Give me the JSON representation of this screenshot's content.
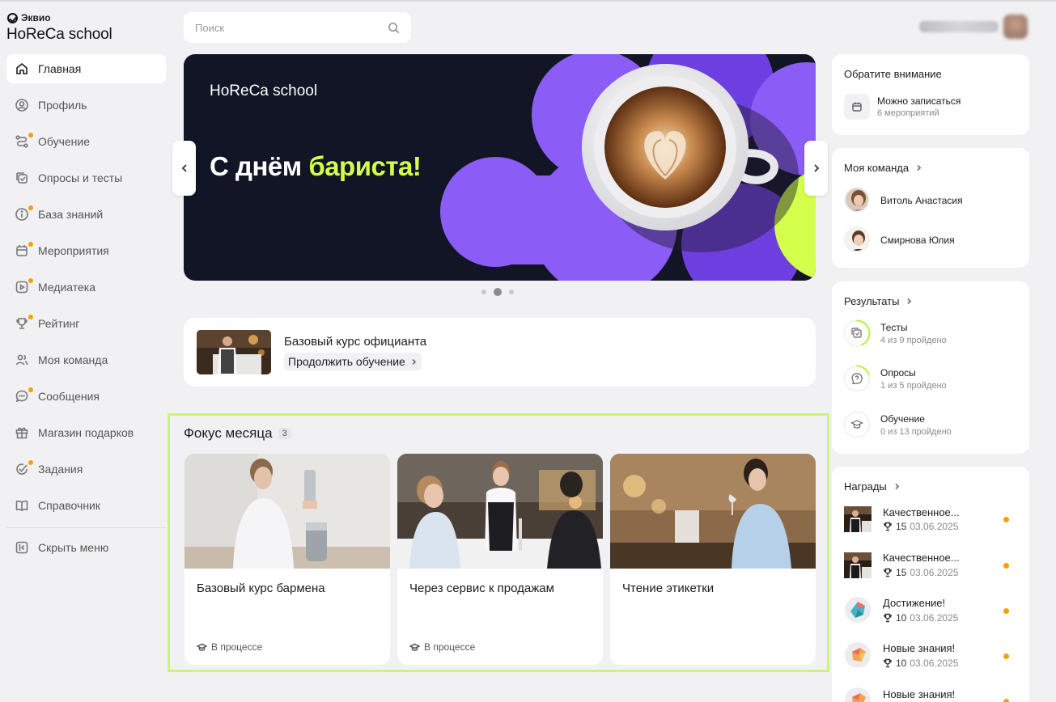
{
  "app": {
    "brand_small": "Эквио",
    "brand_title": "HoReCa school"
  },
  "sidebar": {
    "items": [
      {
        "label": "Главная",
        "icon": "home-icon",
        "active": true,
        "dot": false
      },
      {
        "label": "Профиль",
        "icon": "profile-icon",
        "active": false,
        "dot": false
      },
      {
        "label": "Обучение",
        "icon": "learning-icon",
        "active": false,
        "dot": true
      },
      {
        "label": "Опросы и тесты",
        "icon": "tests-icon",
        "active": false,
        "dot": false
      },
      {
        "label": "База знаний",
        "icon": "info-icon",
        "active": false,
        "dot": true
      },
      {
        "label": "Мероприятия",
        "icon": "calendar-icon",
        "active": false,
        "dot": true
      },
      {
        "label": "Медиатека",
        "icon": "play-icon",
        "active": false,
        "dot": true
      },
      {
        "label": "Рейтинг",
        "icon": "trophy-icon",
        "active": false,
        "dot": true
      },
      {
        "label": "Моя команда",
        "icon": "team-icon",
        "active": false,
        "dot": false
      },
      {
        "label": "Сообщения",
        "icon": "chat-icon",
        "active": false,
        "dot": true
      },
      {
        "label": "Магазин подарков",
        "icon": "gift-icon",
        "active": false,
        "dot": false
      },
      {
        "label": "Задания",
        "icon": "task-icon",
        "active": false,
        "dot": true
      },
      {
        "label": "Справочник",
        "icon": "book-icon",
        "active": false,
        "dot": false
      }
    ],
    "hide_menu": "Скрыть меню"
  },
  "search": {
    "placeholder": "Поиск"
  },
  "banner": {
    "brand": "HoReCa school",
    "title_plain": "С днём ",
    "title_highlight": "бариста!",
    "highlight_color": "#d4ff4a",
    "accent_color": "#8b5cf6",
    "slides": 3,
    "current_slide": 2
  },
  "continue_card": {
    "title": "Базовый курс официанта",
    "button": "Продолжить обучение"
  },
  "focus": {
    "title": "Фокус месяца",
    "count": "3",
    "cards": [
      {
        "title": "Базовый курс бармена",
        "status": "В процессе"
      },
      {
        "title": "Через сервис к продажам",
        "status": "В процессе"
      },
      {
        "title": "Чтение этикетки",
        "status": ""
      }
    ]
  },
  "attention": {
    "title": "Обратите внимание",
    "item_title": "Можно записаться",
    "item_sub": "6 мероприятий"
  },
  "team": {
    "title": "Моя команда",
    "members": [
      "Витоль Анастасия",
      "Смирнова Юлия"
    ]
  },
  "results": {
    "title": "Результаты",
    "items": [
      {
        "label": "Тесты",
        "sub": "4 из 9 пройдено",
        "progress": 0.44
      },
      {
        "label": "Опросы",
        "sub": "1 из 5 пройдено",
        "progress": 0.2
      },
      {
        "label": "Обучение",
        "sub": "0 из 13 пройдено",
        "progress": 0
      }
    ],
    "progress_color": "#b6f23a"
  },
  "awards": {
    "title": "Награды",
    "items": [
      {
        "title": "Качественное...",
        "points": "15",
        "date": "03.06.2025"
      },
      {
        "title": "Качественное...",
        "points": "15",
        "date": "03.06.2025"
      },
      {
        "title": "Достижение!",
        "points": "10",
        "date": "03.06.2025"
      },
      {
        "title": "Новые знания!",
        "points": "10",
        "date": "03.06.2025"
      },
      {
        "title": "Новые знания!",
        "points": "",
        "date": ""
      }
    ]
  }
}
